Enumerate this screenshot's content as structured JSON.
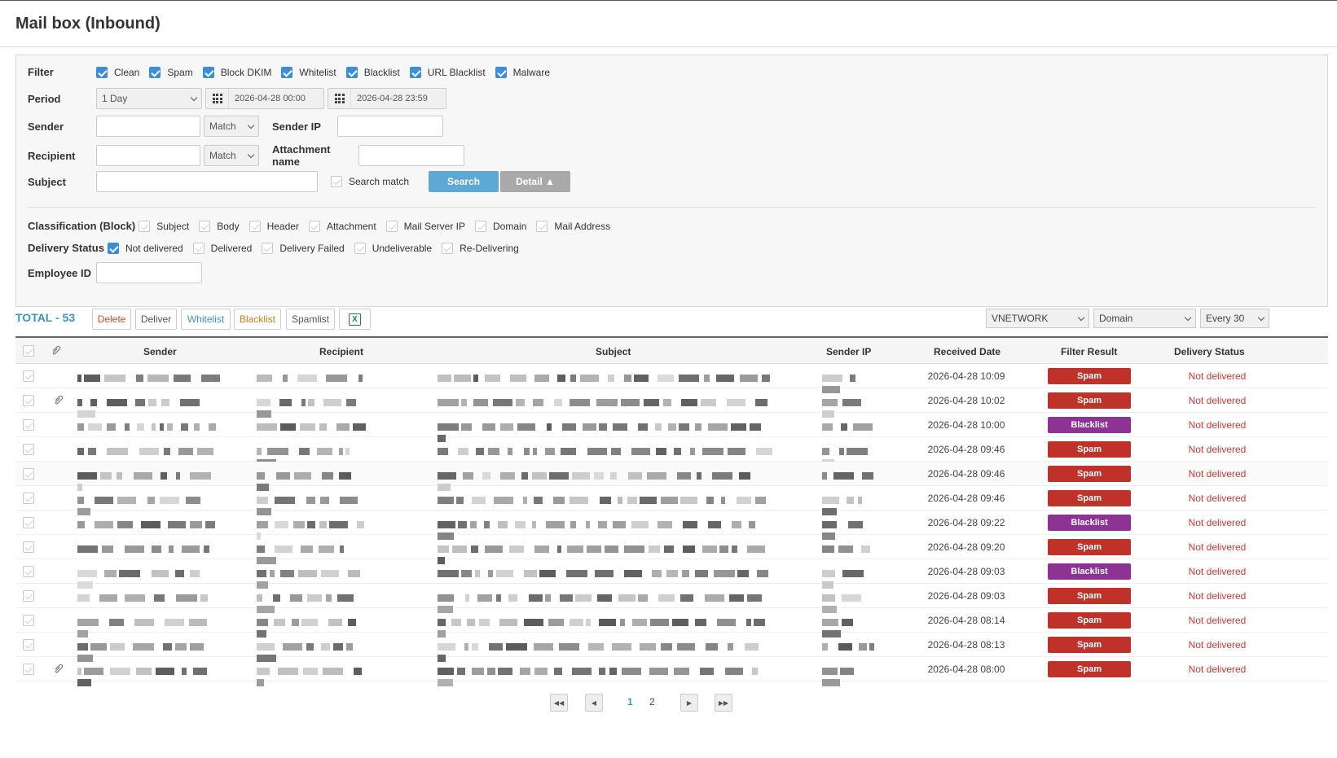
{
  "page": {
    "title": "Mail box (Inbound)"
  },
  "filters": {
    "filter_label": "Filter",
    "filter_options": [
      {
        "label": "Clean",
        "checked": true
      },
      {
        "label": "Spam",
        "checked": true
      },
      {
        "label": "Block DKIM",
        "checked": true
      },
      {
        "label": "Whitelist",
        "checked": true
      },
      {
        "label": "Blacklist",
        "checked": true
      },
      {
        "label": "URL Blacklist",
        "checked": true
      },
      {
        "label": "Malware",
        "checked": true
      }
    ],
    "period_label": "Period",
    "period_value": "1 Day",
    "date_from": "2026-04-28 00:00",
    "date_to": "2026-04-28 23:59",
    "sender_label": "Sender",
    "sender_value": "",
    "sender_match": "Match",
    "sender_ip_label": "Sender IP",
    "sender_ip_value": "",
    "recipient_label": "Recipient",
    "recipient_value": "",
    "recipient_match": "Match",
    "attachment_label": "Attachment name",
    "attachment_value": "",
    "subject_label": "Subject",
    "subject_value": "",
    "search_match_label": "Search match",
    "search_button": "Search",
    "detail_button": "Detail ▲",
    "classification_label": "Classification (Block)",
    "classification_options": [
      {
        "label": "Subject",
        "checked": false
      },
      {
        "label": "Body",
        "checked": false
      },
      {
        "label": "Header",
        "checked": false
      },
      {
        "label": "Attachment",
        "checked": false
      },
      {
        "label": "Mail Server IP",
        "checked": false
      },
      {
        "label": "Domain",
        "checked": false
      },
      {
        "label": "Mail Address",
        "checked": false
      }
    ],
    "delivery_label": "Delivery Status",
    "delivery_options": [
      {
        "label": "Not delivered",
        "checked": true
      },
      {
        "label": "Delivered",
        "checked": false
      },
      {
        "label": "Delivery Failed",
        "checked": false
      },
      {
        "label": "Undeliverable",
        "checked": false
      },
      {
        "label": "Re-Delivering",
        "checked": false
      }
    ],
    "employee_label": "Employee ID",
    "employee_value": ""
  },
  "toolbar": {
    "total": "TOTAL - 53",
    "delete": "Delete",
    "deliver": "Deliver",
    "whitelist": "Whitelist",
    "blacklist": "Blacklist",
    "spamlist": "Spamlist",
    "excel_icon": "excel-icon",
    "company_select": "VNETWORK",
    "scope_select": "Domain",
    "refresh_select": "Every 30"
  },
  "table": {
    "columns": [
      "Sender",
      "Recipient",
      "Subject",
      "Sender IP",
      "Received Date",
      "Filter Result",
      "Delivery Status"
    ],
    "rows": [
      {
        "date": "2026-04-28 10:09",
        "result": "Spam",
        "status": "Not delivered",
        "attach": false
      },
      {
        "date": "2026-04-28 10:02",
        "result": "Spam",
        "status": "Not delivered",
        "attach": true
      },
      {
        "date": "2026-04-28 10:00",
        "result": "Blacklist",
        "status": "Not delivered",
        "attach": false
      },
      {
        "date": "2026-04-28 09:46",
        "result": "Spam",
        "status": "Not delivered",
        "attach": false
      },
      {
        "date": "2026-04-28 09:46",
        "result": "Spam",
        "status": "Not delivered",
        "attach": false
      },
      {
        "date": "2026-04-28 09:46",
        "result": "Spam",
        "status": "Not delivered",
        "attach": false
      },
      {
        "date": "2026-04-28 09:22",
        "result": "Blacklist",
        "status": "Not delivered",
        "attach": false
      },
      {
        "date": "2026-04-28 09:20",
        "result": "Spam",
        "status": "Not delivered",
        "attach": false
      },
      {
        "date": "2026-04-28 09:03",
        "result": "Blacklist",
        "status": "Not delivered",
        "attach": false
      },
      {
        "date": "2026-04-28 09:03",
        "result": "Spam",
        "status": "Not delivered",
        "attach": false
      },
      {
        "date": "2026-04-28 08:14",
        "result": "Spam",
        "status": "Not delivered",
        "attach": false
      },
      {
        "date": "2026-04-28 08:13",
        "result": "Spam",
        "status": "Not delivered",
        "attach": false
      },
      {
        "date": "2026-04-28 08:00",
        "result": "Spam",
        "status": "Not delivered",
        "attach": true
      }
    ]
  },
  "pagination": {
    "pages": [
      "1",
      "2"
    ],
    "current": "1"
  },
  "colors": {
    "spam": "#c0312a",
    "blacklist": "#8e3296",
    "status_red": "#d9352f",
    "accent_blue": "#3a95c8"
  }
}
